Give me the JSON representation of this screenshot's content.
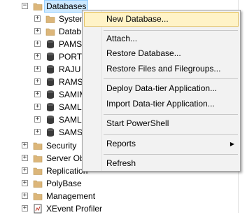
{
  "tree": {
    "databases_label": "Databases",
    "children": [
      {
        "label": "System",
        "icon": "folder-icon"
      },
      {
        "label": "Datab",
        "icon": "folder-icon"
      },
      {
        "label": "PAMS",
        "icon": "database-icon"
      },
      {
        "label": "PORT",
        "icon": "database-icon"
      },
      {
        "label": "RAJU",
        "icon": "database-icon"
      },
      {
        "label": "RAMS",
        "icon": "database-icon"
      },
      {
        "label": "SAMIM",
        "icon": "database-icon"
      },
      {
        "label": "SAML",
        "icon": "database-icon"
      },
      {
        "label": "SAML",
        "icon": "database-icon"
      },
      {
        "label": "SAMS",
        "icon": "database-icon"
      }
    ],
    "siblings": [
      {
        "label": "Security",
        "icon": "folder-icon"
      },
      {
        "label": "Server Ob",
        "icon": "folder-icon"
      },
      {
        "label": "Replication",
        "icon": "folder-icon"
      },
      {
        "label": "PolyBase",
        "icon": "folder-icon"
      },
      {
        "label": "Management",
        "icon": "folder-icon"
      },
      {
        "label": "XEvent Profiler",
        "icon": "profiler-icon"
      }
    ]
  },
  "context_menu": {
    "items": [
      {
        "label": "New Database...",
        "highlighted": true
      },
      {
        "label": "Attach..."
      },
      {
        "label": "Restore Database..."
      },
      {
        "label": "Restore Files and Filegroups..."
      },
      {
        "label": "Deploy Data-tier Application..."
      },
      {
        "label": "Import Data-tier Application..."
      },
      {
        "label": "Start PowerShell"
      },
      {
        "label": "Reports",
        "submenu": true
      },
      {
        "label": "Refresh"
      }
    ]
  },
  "colors": {
    "selection": "#cce8ff",
    "menu_highlight": "#fff3c7",
    "folder": "#dcb67a",
    "database": "#3a3a3a"
  }
}
